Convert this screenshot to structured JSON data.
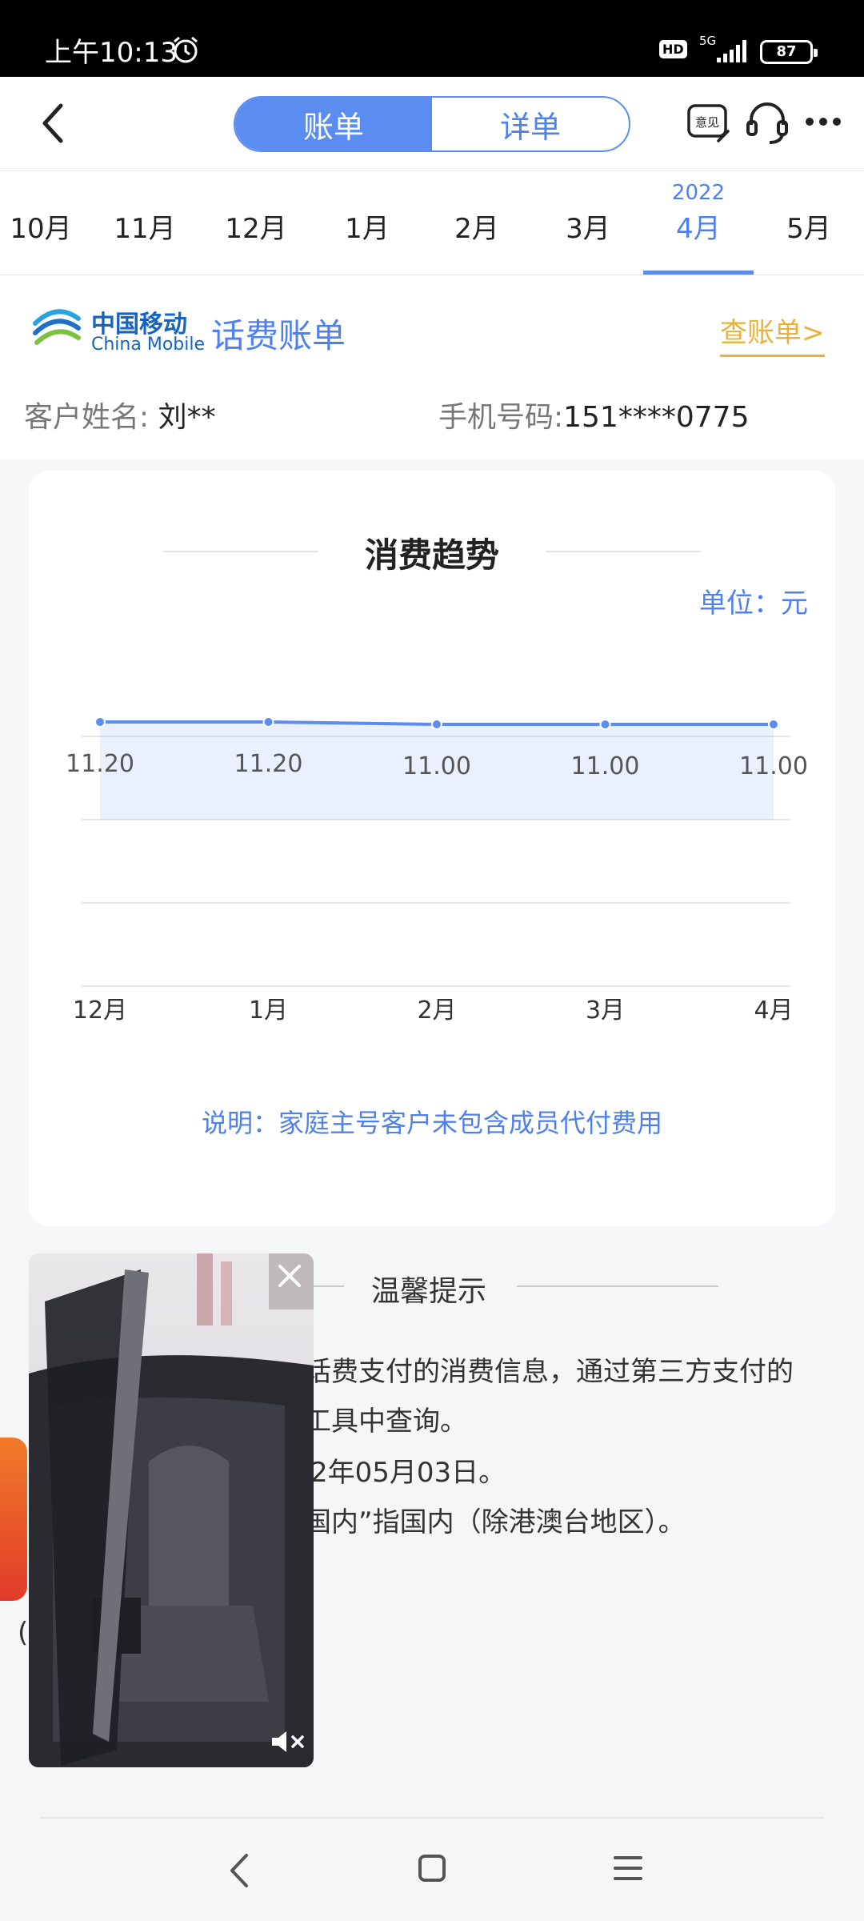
{
  "status_bar": {
    "time": "上午10:13",
    "hd": "HD",
    "network": "5G",
    "battery": "87"
  },
  "header": {
    "tabs": [
      {
        "label": "账单",
        "active": true
      },
      {
        "label": "详单",
        "active": false
      }
    ]
  },
  "months": {
    "year_label": "2022",
    "items": [
      "10月",
      "11月",
      "12月",
      "1月",
      "2月",
      "3月",
      "4月",
      "5月"
    ],
    "selected": "4月"
  },
  "bill": {
    "brand_cn": "中国移动",
    "brand_en": "China Mobile",
    "title": "话费账单",
    "view_link": "查账单>",
    "customer_label": "客户姓名:",
    "customer_name": "刘**",
    "phone_label": "手机号码:",
    "phone": "151****0775"
  },
  "trend": {
    "title": "消费趋势",
    "unit": "单位：元",
    "note": "说明：家庭主号客户未包含成员代付费用"
  },
  "chart_data": {
    "type": "area",
    "categories": [
      "12月",
      "1月",
      "2月",
      "3月",
      "4月"
    ],
    "values": [
      11.2,
      11.2,
      11.0,
      11.0,
      11.0
    ],
    "value_labels": [
      "11.20",
      "11.20",
      "11.00",
      "11.00",
      "11.00"
    ],
    "title": "消费趋势",
    "unit": "单位：元",
    "grid": true,
    "color": "#5b8cf0"
  },
  "tips": {
    "title": "温馨提示",
    "lines": [
      "话费支付的消费信息，通过第三方支付的",
      "工具中查询。",
      "2年05月03日。",
      "国内”指国内（除港澳台地区）。"
    ]
  },
  "side": {
    "paren": "("
  },
  "colors": {
    "accent": "#5b8cf0",
    "link": "#4f80ec",
    "orange": "#eab03a"
  }
}
